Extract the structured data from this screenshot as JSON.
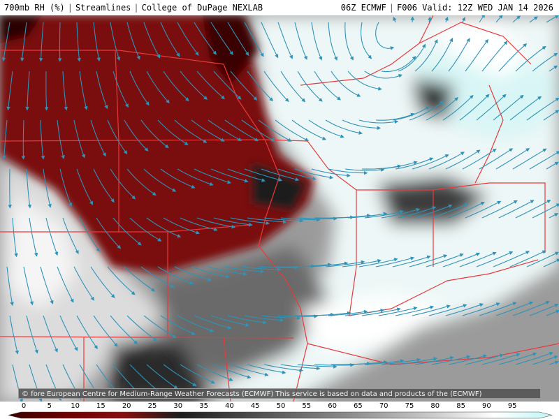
{
  "header": {
    "product": "700mb RH (%)",
    "layer": "Streamlines",
    "source": "College of DuPage NEXLAB",
    "run": "06Z ECMWF",
    "valid": "F006 Valid: 12Z WED JAN 14 2026"
  },
  "credit": "© fore European Centre for Medium-Range Weather Forecasts (ECMWF)  This service is based on data and products of the (ECMWF)",
  "colorbar": {
    "ticks": [
      "0",
      "5",
      "10",
      "15",
      "20",
      "25",
      "30",
      "35",
      "40",
      "45",
      "50",
      "55",
      "60",
      "65",
      "70",
      "75",
      "80",
      "85",
      "90",
      "95"
    ],
    "stops": [
      {
        "value": 0,
        "color": "#3a0000"
      },
      {
        "value": 10,
        "color": "#6e0000"
      },
      {
        "value": 20,
        "color": "#8a1010"
      },
      {
        "value": 30,
        "color": "#1c1c1c"
      },
      {
        "value": 45,
        "color": "#555555"
      },
      {
        "value": 60,
        "color": "#8f8f8f"
      },
      {
        "value": 75,
        "color": "#cfcfcf"
      },
      {
        "value": 85,
        "color": "#ffffff"
      },
      {
        "value": 95,
        "color": "#bff5f5"
      }
    ]
  },
  "colors": {
    "streamline": "#2e93b8",
    "borders": "#e83a3a",
    "dry": "#7a0a0a",
    "moist": "#f4fbfb"
  }
}
